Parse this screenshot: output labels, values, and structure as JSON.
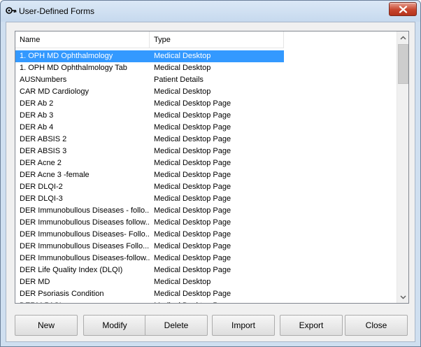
{
  "window": {
    "title": "User-Defined Forms",
    "icon": "forms-key-icon",
    "close_icon": "close-x-icon"
  },
  "list": {
    "columns": [
      "Name",
      "Type"
    ],
    "selected_index": 0,
    "rows": [
      {
        "name": "1. OPH MD Ophthalmology",
        "type": "Medical Desktop"
      },
      {
        "name": "1. OPH MD Ophthalmology Tab",
        "type": "Medical Desktop"
      },
      {
        "name": "AUSNumbers",
        "type": "Patient Details"
      },
      {
        "name": "CAR MD Cardiology",
        "type": "Medical Desktop"
      },
      {
        "name": "DER Ab 2",
        "type": "Medical Desktop Page"
      },
      {
        "name": "DER Ab 3",
        "type": "Medical Desktop Page"
      },
      {
        "name": "DER Ab 4",
        "type": "Medical Desktop Page"
      },
      {
        "name": "DER ABSIS 2",
        "type": "Medical Desktop Page"
      },
      {
        "name": "DER ABSIS 3",
        "type": "Medical Desktop Page"
      },
      {
        "name": "DER Acne 2",
        "type": "Medical Desktop Page"
      },
      {
        "name": "DER Acne 3 -female",
        "type": "Medical Desktop Page"
      },
      {
        "name": "DER DLQI-2",
        "type": "Medical Desktop Page"
      },
      {
        "name": "DER DLQI-3",
        "type": "Medical Desktop Page"
      },
      {
        "name": "DER Immunobullous Diseases - follo...",
        "type": "Medical Desktop Page"
      },
      {
        "name": "DER Immunobullous Diseases follow...",
        "type": "Medical Desktop Page"
      },
      {
        "name": "DER Immunobullous Diseases- Follo...",
        "type": "Medical Desktop Page"
      },
      {
        "name": "DER Immunobullous Diseases Follo...",
        "type": "Medical Desktop Page"
      },
      {
        "name": "DER Immunobullous Diseases-follow...",
        "type": "Medical Desktop Page"
      },
      {
        "name": "DER Life Quality Index (DLQI)",
        "type": "Medical Desktop Page"
      },
      {
        "name": "DER MD",
        "type": "Medical Desktop"
      },
      {
        "name": "DER Psoriasis Condition",
        "type": "Medical Desktop Page"
      },
      {
        "name": "DERM PASI",
        "type": "Medical Desktop Page"
      }
    ]
  },
  "buttons": {
    "new": "New",
    "modify": "Modify",
    "delete": "Delete",
    "import": "Import",
    "export": "Export",
    "close": "Close"
  },
  "colors": {
    "selection": "#3399ff",
    "close_button": "#c7452d"
  }
}
